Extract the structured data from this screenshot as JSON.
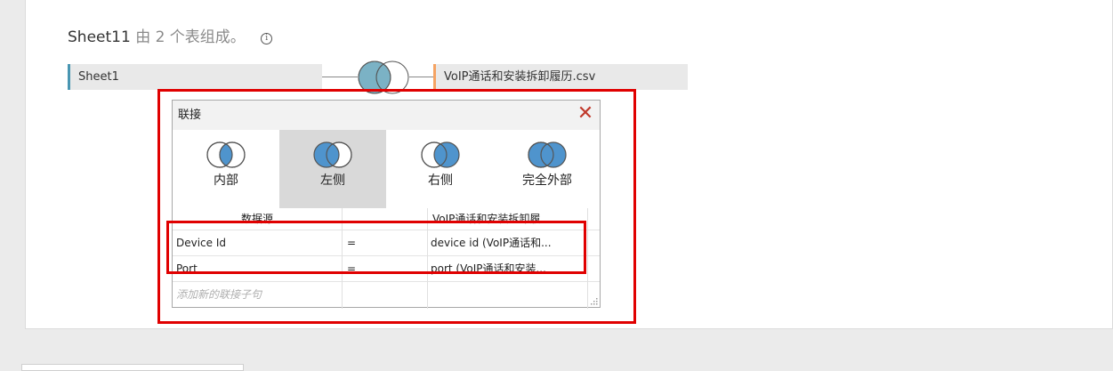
{
  "header": {
    "sheet_name": "Sheet11",
    "description": "由 2 个表组成。",
    "info_icon": "i"
  },
  "tables": {
    "left": "Sheet1",
    "right": "VoIP通话和安装拆卸履历.csv"
  },
  "join_dialog": {
    "title": "联接",
    "close": "✕",
    "join_types": [
      {
        "label": "内部",
        "icon": "inner-join-icon",
        "selected": false
      },
      {
        "label": "左侧",
        "icon": "left-join-icon",
        "selected": true
      },
      {
        "label": "右侧",
        "icon": "right-join-icon",
        "selected": false
      },
      {
        "label": "完全外部",
        "icon": "full-outer-join-icon",
        "selected": false
      }
    ],
    "columns": {
      "left": "数据源",
      "right": "VoIP通话和安装拆卸履..."
    },
    "clauses": [
      {
        "left": "Device Id",
        "op": "=",
        "right": "device id (VoIP通话和..."
      },
      {
        "left": "Port",
        "op": "=",
        "right": "port (VoIP通话和安装..."
      }
    ],
    "add_clause": "添加新的联接子句"
  },
  "colors": {
    "join_blue": "#4f94cd",
    "venn_main_fill": "#7bb2c5",
    "left_accent": "#4996b2",
    "right_accent": "#f5a363",
    "highlight": "#e00000"
  }
}
